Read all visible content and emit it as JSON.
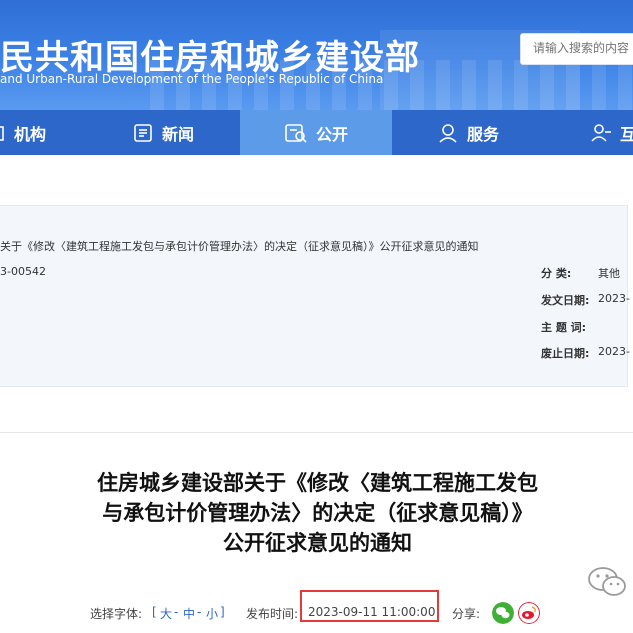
{
  "header": {
    "title": "民共和国住房和城乡建设部",
    "subtitle": "and Urban-Rural Development of the People's Republic of China",
    "search_placeholder": "请输入搜索的内容"
  },
  "nav": {
    "items": [
      {
        "label": "机构",
        "icon": "building-icon"
      },
      {
        "label": "新闻",
        "icon": "news-icon"
      },
      {
        "label": "公开",
        "icon": "disclosure-icon",
        "active": true
      },
      {
        "label": "服务",
        "icon": "service-icon"
      },
      {
        "label": "互",
        "icon": "interaction-icon"
      }
    ]
  },
  "info": {
    "doc_title": "关于《修改〈建筑工程施工发包与承包计价管理办法〉的决定（征求意见稿）》公开征求意见的通知",
    "doc_number": "3-00542",
    "category_label": "分    类:",
    "category_value": "其他",
    "issue_date_label": "发文日期:",
    "issue_date_value": "2023-",
    "subject_label": "主 题 词:",
    "subject_value": "",
    "expire_date_label": "废止日期:",
    "expire_date_value": "2023-"
  },
  "article": {
    "title_line1": "住房城乡建设部关于《修改〈建筑工程施工发包",
    "title_line2": "与承包计价管理办法〉的决定（征求意见稿）》",
    "title_line3": "公开征求意见的通知"
  },
  "bottom": {
    "font_label": "选择字体:",
    "font_open": "[",
    "font_large": "大",
    "font_medium": "中",
    "font_small": "小",
    "font_sep": "-",
    "font_close": "]",
    "publish_label": "发布时间:",
    "publish_time": "2023-09-11 11:00:00",
    "share_label": "分享:"
  },
  "colors": {
    "accent": "#2c67c9",
    "highlight": "#e23b3b",
    "wechat": "#3eb135",
    "weibo": "#e6162d"
  }
}
